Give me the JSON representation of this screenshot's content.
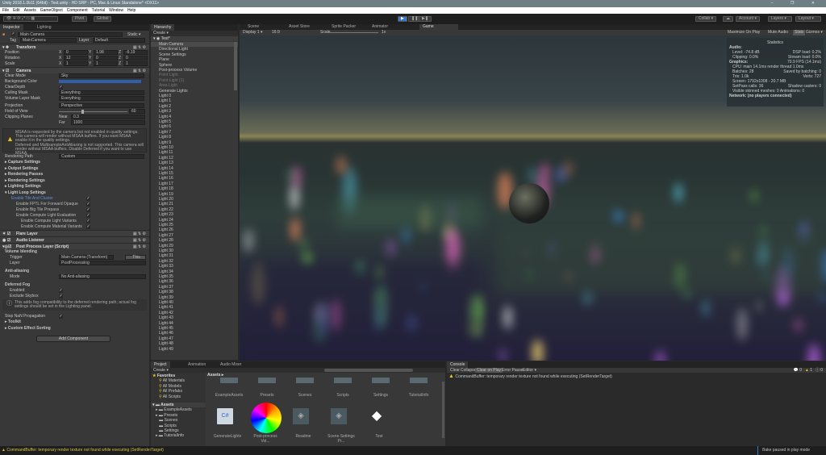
{
  "window": {
    "title": "Unity 2018.1.0b11 (64bit) - Test.unity - HD SRP - PC, Mac & Linux Standalone* <DX11>",
    "controls": "– ❐ ✕"
  },
  "menu": [
    "File",
    "Edit",
    "Assets",
    "GameObject",
    "Component",
    "Tutorial",
    "Window",
    "Help"
  ],
  "toolbar": {
    "pivot": "Pivot",
    "global": "Global",
    "play": "▶",
    "pause": "❚❚",
    "step": "▶❚",
    "collab": "Collab ▾",
    "account": "Account ▾",
    "layers": "Layers ▾",
    "layout": "Layout ▾"
  },
  "inspector": {
    "tabs": [
      "Inspector",
      "Lighting"
    ],
    "object_name": "Main Camera",
    "static": "Static ▾",
    "tag_label": "Tag",
    "tag": "MainCamera",
    "layer_label": "Layer",
    "layer": "Default",
    "transform": {
      "title": "Transform",
      "rows": [
        [
          "Position",
          "0",
          "1.98",
          "-6.19"
        ],
        [
          "Rotation",
          "12",
          "0",
          "0"
        ],
        [
          "Scale",
          "1",
          "1",
          "1"
        ]
      ]
    },
    "camera": {
      "title": "Camera",
      "clear_mode_label": "Clear Mode",
      "clear_mode": "Sky",
      "bg_label": "Background Color",
      "clear_depth": "ClearDepth",
      "culling_label": "Culling Mask",
      "culling": "Everything",
      "volume_label": "Volume Layer Mask",
      "volume": "Everything",
      "projection_label": "Projection",
      "projection": "Perspective",
      "fov_label": "Field of View",
      "fov": "60",
      "fov_fraction": 0.33,
      "clip_label": "Clipping Planes",
      "near_label": "Near",
      "near": "0.3",
      "far_label": "Far",
      "far": "1000",
      "warning": "MSAA is requested by the camera but not enabled in quality settings. This camera will render without MSAA buffers. If you want MSAA enable it in the quality settings.",
      "warning2": "Deferred and MultisampleAntiAliasing is not supported. This camera will render without MSAA buffers. Disable Deferred if you want to use MSAA.",
      "render_path_label": "Rendering Path",
      "render_path": "Custom"
    },
    "sections": [
      "Capture Settings",
      "Output Settings",
      "Rendering Passes",
      "Rendering Settings",
      "Lighting Settings",
      "Light Loop Settings"
    ],
    "light_loop": [
      "Enable Tile And Cluster",
      "Enable FPTL For Forward Opaque",
      "Enable Big Tile Prepass",
      "Enable Compute Light Evaluation",
      "Enable Compute Light Variants",
      "Enable Compute Material Variants"
    ],
    "components": [
      "Flare Layer",
      "Audio Listener",
      "Post Process Layer (Script)"
    ],
    "ppl": {
      "volume_blending": "Volume blending",
      "trigger_label": "Trigger",
      "trigger": "Main Camera (Transform)",
      "this": "This",
      "layer_label": "Layer",
      "layer": "PostProcessing",
      "aa": "Anti-aliasing",
      "mode_label": "Mode",
      "mode": "No Anti-aliasing",
      "fog": "Deferred Fog",
      "enabled": "Enabled",
      "skybox": "Exclude Skybox",
      "fog_info": "This adds fog compatibility to the deferred rendering path; actual fog settings should be set in the Lighting panel.",
      "nan": "Stop NaN Propagation",
      "toolkit": "Toolkit",
      "custom": "Custom Effect Sorting"
    },
    "add_component": "Add Component"
  },
  "hierarchy": {
    "tab": "Hierarchy",
    "create": "Create ▾",
    "scene": "Test*",
    "items": [
      "Main Camera",
      "Directional Light",
      "Scene Settings",
      "Plane",
      "Sphere",
      "Post-process Volume",
      "Point Light",
      "Point Light (1)",
      "Area Light",
      "Generate Lights",
      "Light 0",
      "Light 1",
      "Light 2",
      "Light 3",
      "Light 4",
      "Light 5",
      "Light 6",
      "Light 7",
      "Light 8",
      "Light 9",
      "Light 10",
      "Light 11",
      "Light 12",
      "Light 13",
      "Light 14",
      "Light 15",
      "Light 16",
      "Light 17",
      "Light 18",
      "Light 19",
      "Light 20",
      "Light 21",
      "Light 22",
      "Light 23",
      "Light 24",
      "Light 25",
      "Light 26",
      "Light 27",
      "Light 28",
      "Light 29",
      "Light 30",
      "Light 31",
      "Light 32",
      "Light 33",
      "Light 34",
      "Light 35",
      "Light 36",
      "Light 37",
      "Light 38",
      "Light 39",
      "Light 40",
      "Light 41",
      "Light 42",
      "Light 43",
      "Light 44",
      "Light 45",
      "Light 46",
      "Light 47",
      "Light 48",
      "Light 49"
    ],
    "disabled": [
      6,
      7,
      8
    ]
  },
  "view_tabs": [
    "Scene",
    "Asset Store",
    "Sprite Packer",
    "Animator",
    "Game"
  ],
  "game": {
    "display": "Display 1 ▾",
    "aspect": "16:9",
    "scale_label": "Scale",
    "scale": "1x",
    "maximize": "Maximize On Play",
    "mute": "Mute Audio",
    "stats": "Stats",
    "gizmos": "Gizmos ▾"
  },
  "stats": {
    "title": "Statistics",
    "audio": "Audio:",
    "level": "Level: -74.8 dB",
    "dsp": "DSP load: 0.2%",
    "clipping": "Clipping: 0.0%",
    "stream": "Stream load: 0.0%",
    "graphics": "Graphics:",
    "fps": "70.9 FPS (14.1ms)",
    "cpu": "CPU: main 14.1ms  render thread 1.0ms",
    "batches": "Batches: 28",
    "saved": "Saved by batching: 0",
    "tris": "Tris: 1.0k",
    "verts": "Verts: 727",
    "screen": "Screen: 1792x1008 - 20.7 MB",
    "setpass": "SetPass calls: 36",
    "shadow": "Shadow casters: 0",
    "skinned": "Visible skinned meshes: 0  Animations: 0",
    "network": "Network: (no players connected)"
  },
  "project": {
    "tabs": [
      "Project",
      "Animation",
      "Audio Mixer"
    ],
    "create": "Create ▾",
    "favorites": "Favorites",
    "fav_items": [
      "All Materials",
      "All Models",
      "All Prefabs",
      "All Scripts"
    ],
    "assets": "Assets",
    "asset_tree": [
      "ExampleAssets",
      "Presets",
      "Scenes",
      "Scripts",
      "Settings",
      "TutorialInfo"
    ],
    "breadcrumb": "Assets ▸",
    "folders": [
      "ExampleAssets",
      "Presets",
      "Scenes",
      "Scripts",
      "Settings",
      "TutorialInfo"
    ],
    "files": [
      "GenerateLights",
      "Post-process Vol...",
      "Readme",
      "Scene Settings Pr...",
      "Test"
    ]
  },
  "console": {
    "tab": "Console",
    "buttons": [
      "Clear",
      "Collapse",
      "Clear on Play",
      "Error Pause",
      "Editor ▾"
    ],
    "counts": [
      "0",
      "1",
      "0"
    ],
    "message": "CommandBuffer: temporary render texture  not found while executing  (SetRenderTarget)"
  },
  "status": {
    "message": "CommandBuffer: temporary render texture  not found while executing  (SetRenderTarget)",
    "right": "Bake paused in play mode"
  },
  "colors": {
    "accent": "#3c78c8",
    "warning": "#e8c020",
    "bg_color": "#2f5fa8"
  }
}
